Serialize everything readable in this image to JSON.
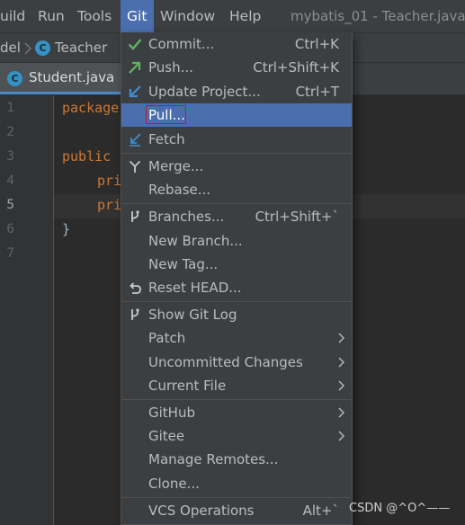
{
  "menubar": {
    "build": "uild",
    "run": "Run",
    "tools": "Tools",
    "git": "Git",
    "window": "Window",
    "help": "Help",
    "title": "mybatis_01 - Teacher.java"
  },
  "breadcrumb": {
    "prev": "del",
    "current": "Teacher"
  },
  "tabs": {
    "active": "Student.java"
  },
  "editor": {
    "line_numbers": [
      "1",
      "2",
      "3",
      "4",
      "5",
      "6",
      "7"
    ],
    "current_line": "5",
    "lines": {
      "l1": "package",
      "l3": "public",
      "l4": "pri",
      "l5": "pri",
      "l6": "}"
    }
  },
  "git_menu": {
    "commit": {
      "label": "Commit...",
      "shortcut": "Ctrl+K"
    },
    "push": {
      "label": "Push...",
      "shortcut": "Ctrl+Shift+K"
    },
    "update": {
      "label": "Update Project...",
      "shortcut": "Ctrl+T"
    },
    "pull": {
      "label": "Pull..."
    },
    "fetch": {
      "label": "Fetch"
    },
    "merge": {
      "label": "Merge..."
    },
    "rebase": {
      "label": "Rebase..."
    },
    "branches": {
      "label": "Branches...",
      "shortcut": "Ctrl+Shift+`"
    },
    "new_branch": {
      "label": "New Branch..."
    },
    "new_tag": {
      "label": "New Tag..."
    },
    "reset_head": {
      "label": "Reset HEAD..."
    },
    "show_log": {
      "label": "Show Git Log"
    },
    "patch": {
      "label": "Patch"
    },
    "uncommitted": {
      "label": "Uncommitted Changes"
    },
    "current_file": {
      "label": "Current File"
    },
    "github": {
      "label": "GitHub"
    },
    "gitee": {
      "label": "Gitee"
    },
    "manage_remotes": {
      "label": "Manage Remotes..."
    },
    "clone": {
      "label": "Clone..."
    },
    "vcs_ops": {
      "label": "VCS Operations",
      "shortcut": "Alt+`"
    }
  },
  "watermark": "CSDN @^O^——",
  "colors": {
    "highlight": "#4b6eaf",
    "menu_bg": "#3c3f41",
    "editor_bg": "#2b2b2b",
    "keyword": "#cc7832",
    "focus_border": "#c3192c",
    "commit_icon": "#5fb55f",
    "update_icon": "#3d8fd4"
  }
}
